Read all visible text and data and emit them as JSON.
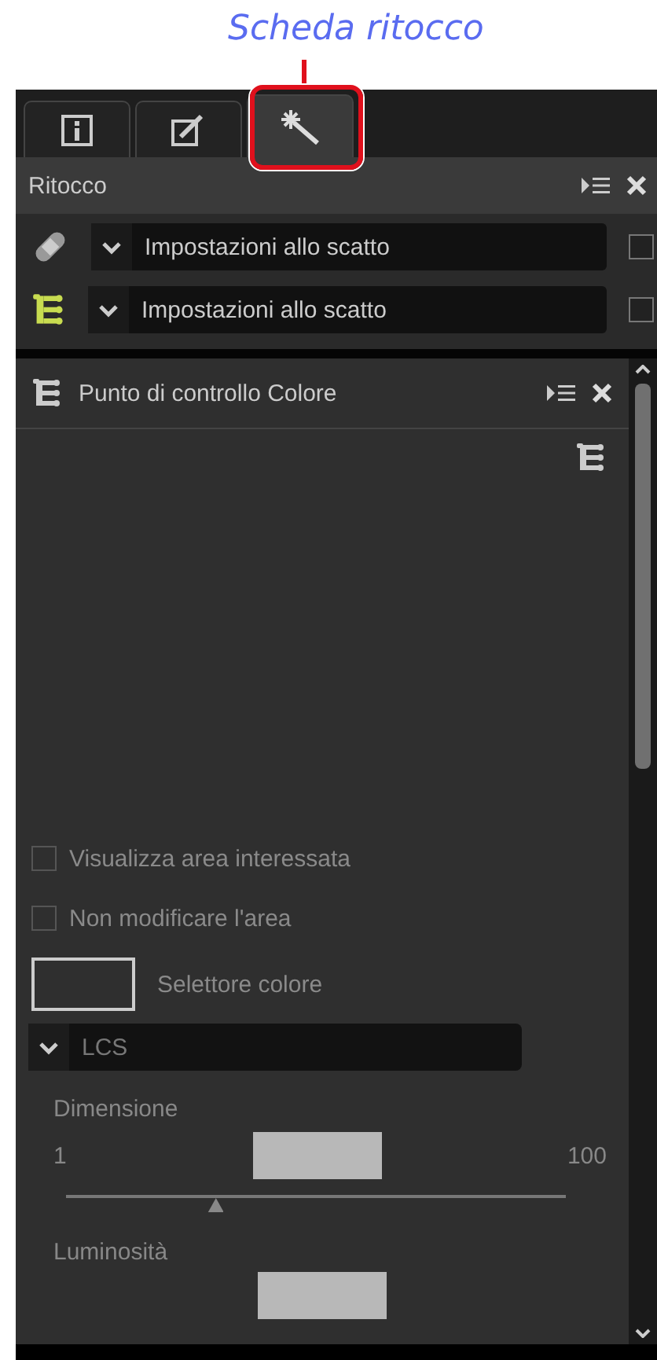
{
  "annotation": {
    "caption": "Scheda ritocco"
  },
  "tabs": [
    {
      "kind": "info",
      "selected": false
    },
    {
      "kind": "edit",
      "selected": false
    },
    {
      "kind": "retouch",
      "selected": true
    }
  ],
  "retouch_panel": {
    "title": "Ritocco",
    "rows": [
      {
        "kind": "bandage",
        "value": "Impostazioni allo scatto",
        "checked": false
      },
      {
        "kind": "control-point",
        "value": "Impostazioni allo scatto",
        "checked": false
      }
    ]
  },
  "color_point_panel": {
    "title": "Punto di controllo Colore",
    "options": [
      {
        "label": "Visualizza area interessata",
        "checked": false
      },
      {
        "label": "Non modificare l'area",
        "checked": false
      }
    ],
    "color_picker": {
      "label": "Selettore colore"
    },
    "mode": {
      "value": "LCS"
    },
    "sliders": [
      {
        "label": "Dimensione",
        "min": "1",
        "max": "100",
        "level": 0.3
      }
    ],
    "next_section": {
      "label": "Luminosità"
    }
  }
}
